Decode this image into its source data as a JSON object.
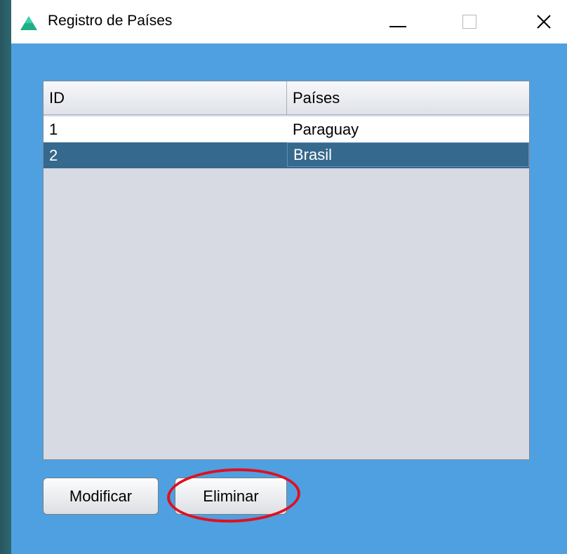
{
  "window": {
    "title": "Registro de Países",
    "accent": "#4fa0e0",
    "app_icon": "mountain-logo-icon",
    "controls": [
      "minimize-icon",
      "maximize-icon",
      "close-icon"
    ]
  },
  "table": {
    "columns": [
      "ID",
      "Países"
    ],
    "rows": [
      {
        "id": "1",
        "pais": "Paraguay",
        "selected": false
      },
      {
        "id": "2",
        "pais": "Brasil",
        "selected": true
      }
    ],
    "selection_color": "#35698d"
  },
  "buttons": {
    "modificar": "Modificar",
    "eliminar": "Eliminar"
  },
  "annotation": {
    "highlight_color": "#e01020",
    "highlight_target": "Eliminar"
  }
}
